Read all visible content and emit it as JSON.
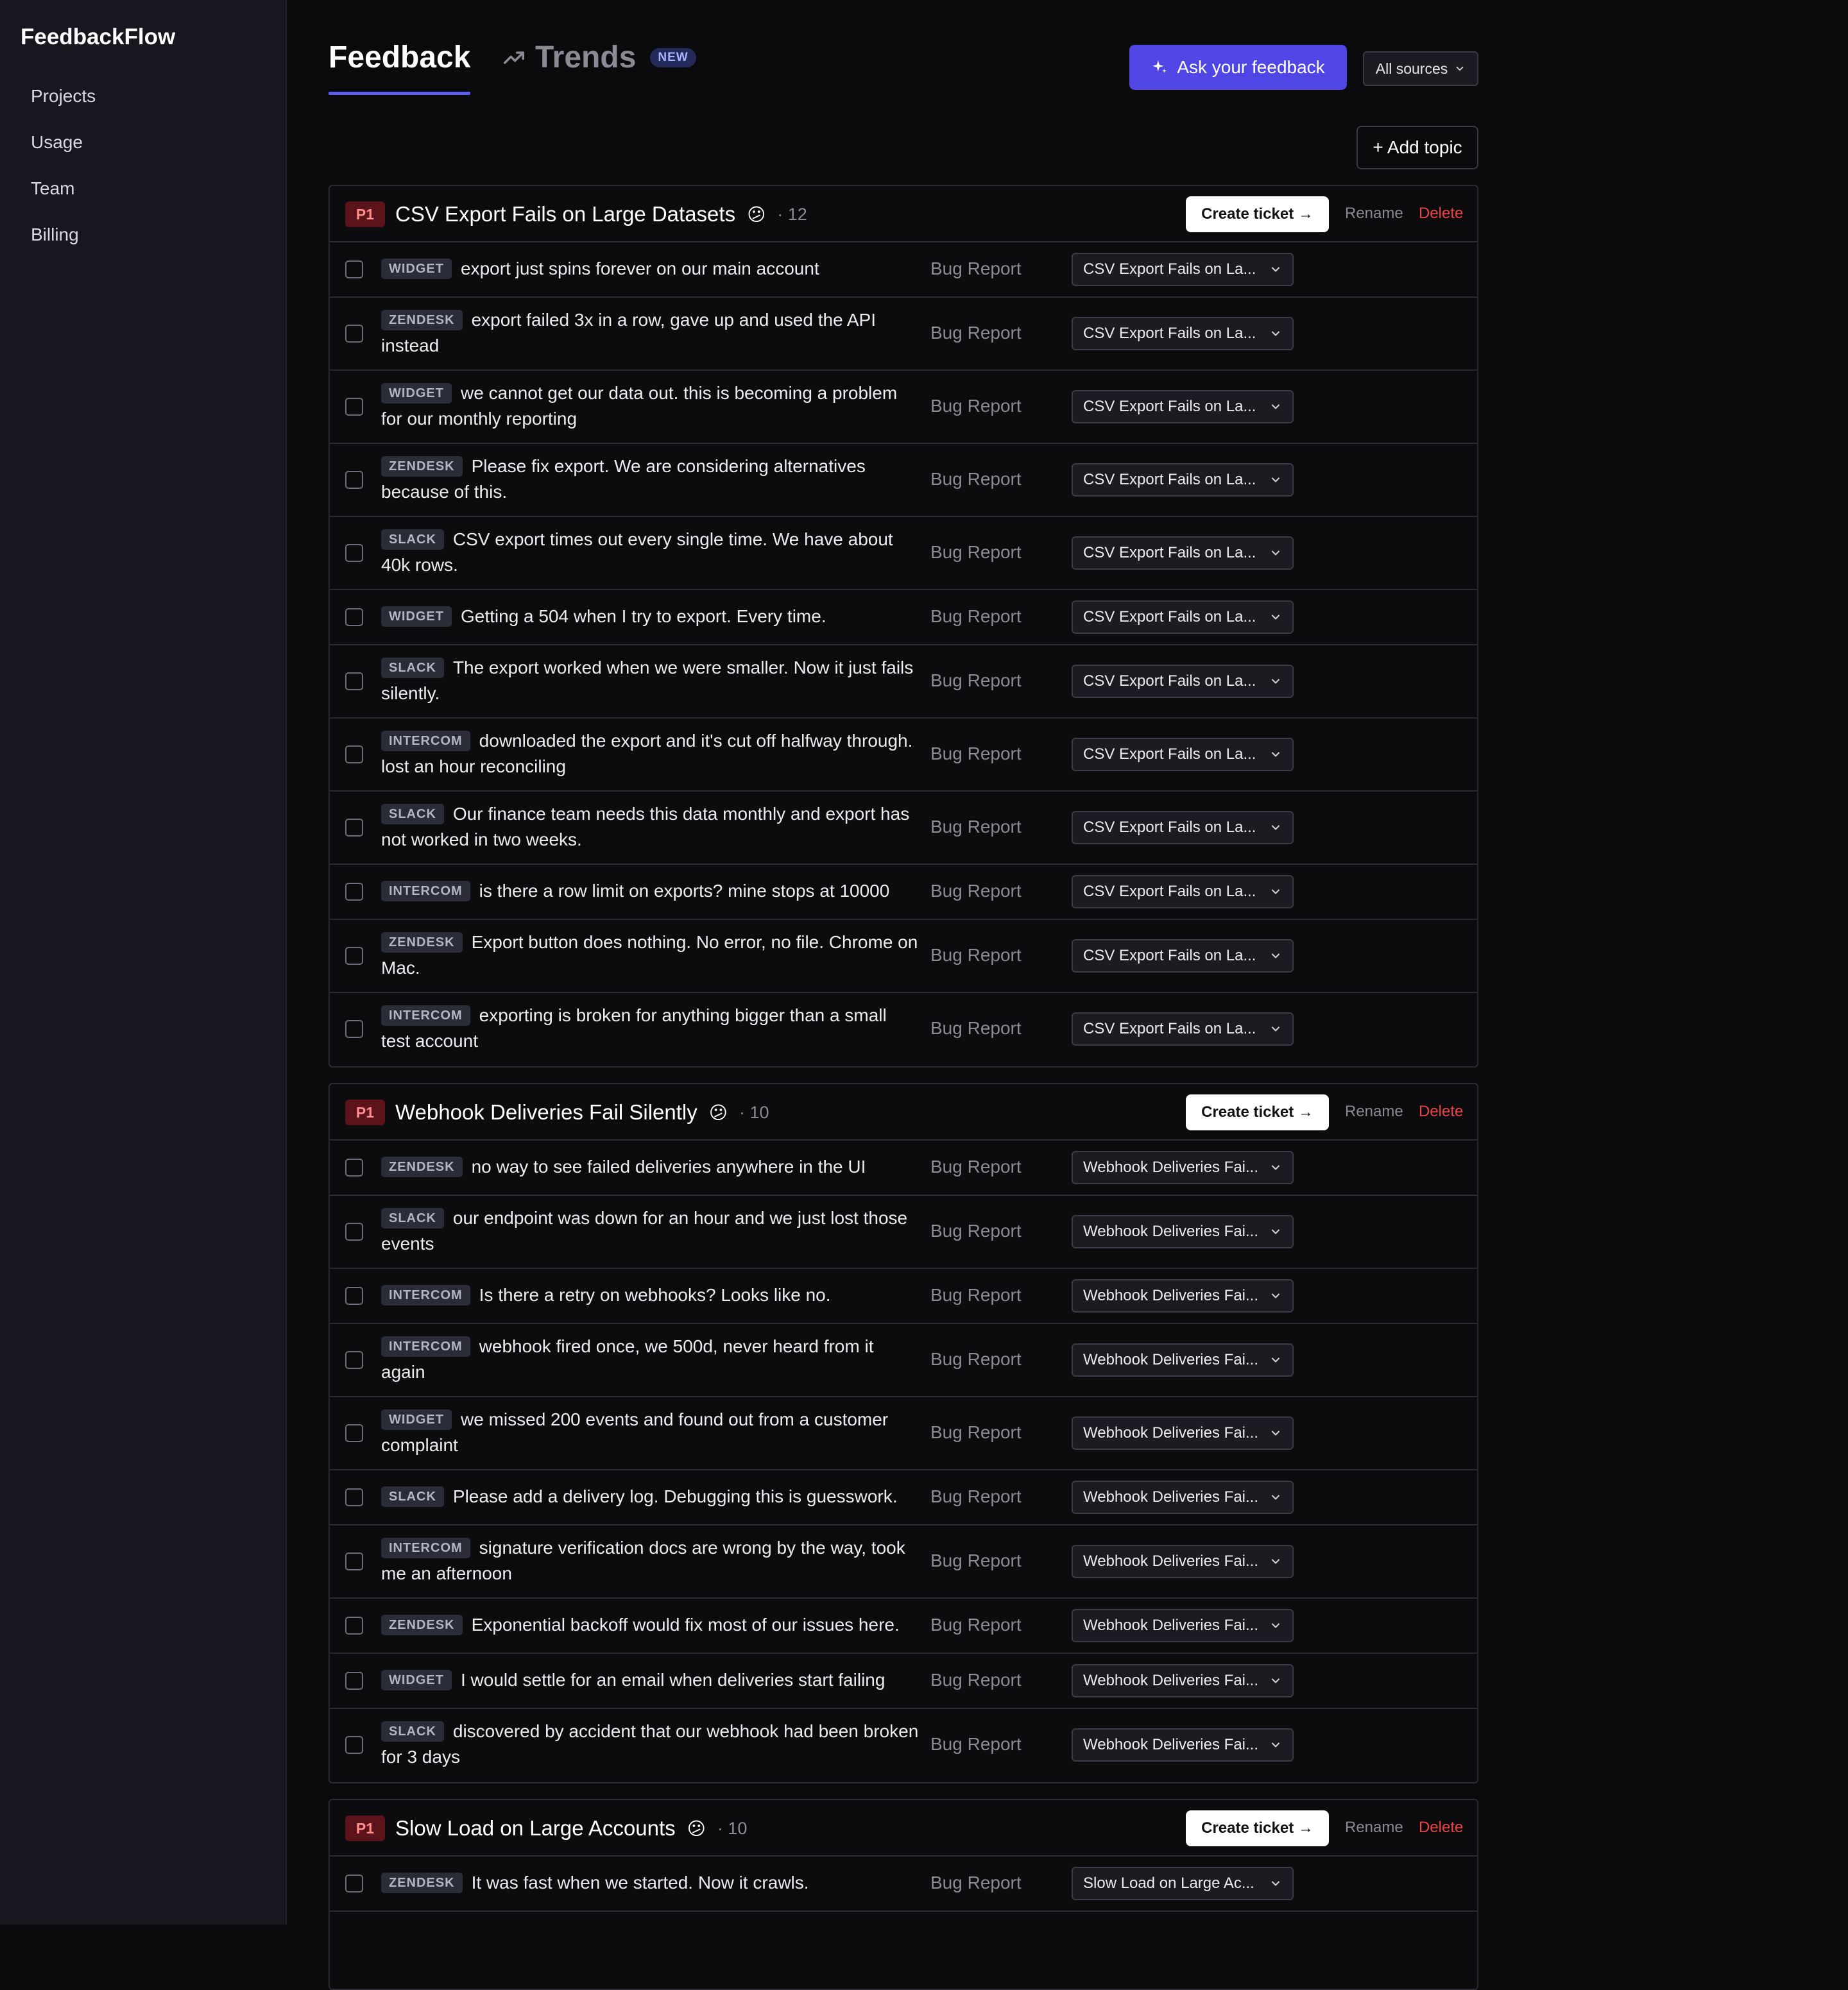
{
  "app": {
    "name": "FeedbackFlow"
  },
  "nav": [
    "Projects",
    "Usage",
    "Team",
    "Billing"
  ],
  "tabs": {
    "feedback": "Feedback",
    "trends": "Trends",
    "trends_badge": "NEW"
  },
  "header": {
    "ask_label": "Ask your feedback",
    "sources_label": "All sources",
    "add_topic_label": "+ Add topic"
  },
  "actions": {
    "create": "Create ticket →",
    "rename": "Rename",
    "delete": "Delete"
  },
  "topics": [
    {
      "priority": "P1",
      "title": "CSV Export Fails on Large Datasets",
      "emoji": "😕",
      "count": "· 12",
      "rows": [
        {
          "source": "WIDGET",
          "text": "export just spins forever on our main account",
          "category": "Bug Report",
          "topic": "CSV Export Fails on La..."
        },
        {
          "source": "ZENDESK",
          "text": "export failed 3x in a row, gave up and used the API instead",
          "category": "Bug Report",
          "topic": "CSV Export Fails on La..."
        },
        {
          "source": "WIDGET",
          "text": "we cannot get our data out. this is becoming a problem for our monthly reporting",
          "category": "Bug Report",
          "topic": "CSV Export Fails on La..."
        },
        {
          "source": "ZENDESK",
          "text": "Please fix export. We are considering alternatives because of this.",
          "category": "Bug Report",
          "topic": "CSV Export Fails on La..."
        },
        {
          "source": "SLACK",
          "text": "CSV export times out every single time. We have about 40k rows.",
          "category": "Bug Report",
          "topic": "CSV Export Fails on La..."
        },
        {
          "source": "WIDGET",
          "text": "Getting a 504 when I try to export. Every time.",
          "category": "Bug Report",
          "topic": "CSV Export Fails on La..."
        },
        {
          "source": "SLACK",
          "text": "The export worked when we were smaller. Now it just fails silently.",
          "category": "Bug Report",
          "topic": "CSV Export Fails on La..."
        },
        {
          "source": "INTERCOM",
          "text": "downloaded the export and it's cut off halfway through. lost an hour reconciling",
          "category": "Bug Report",
          "topic": "CSV Export Fails on La..."
        },
        {
          "source": "SLACK",
          "text": "Our finance team needs this data monthly and export has not worked in two weeks.",
          "category": "Bug Report",
          "topic": "CSV Export Fails on La..."
        },
        {
          "source": "INTERCOM",
          "text": "is there a row limit on exports? mine stops at 10000",
          "category": "Bug Report",
          "topic": "CSV Export Fails on La..."
        },
        {
          "source": "ZENDESK",
          "text": "Export button does nothing. No error, no file. Chrome on Mac.",
          "category": "Bug Report",
          "topic": "CSV Export Fails on La..."
        },
        {
          "source": "INTERCOM",
          "text": "exporting is broken for anything bigger than a small test account",
          "category": "Bug Report",
          "topic": "CSV Export Fails on La..."
        }
      ]
    },
    {
      "priority": "P1",
      "title": "Webhook Deliveries Fail Silently",
      "emoji": "😕",
      "count": "· 10",
      "rows": [
        {
          "source": "ZENDESK",
          "text": "no way to see failed deliveries anywhere in the UI",
          "category": "Bug Report",
          "topic": "Webhook Deliveries Fai..."
        },
        {
          "source": "SLACK",
          "text": "our endpoint was down for an hour and we just lost those events",
          "category": "Bug Report",
          "topic": "Webhook Deliveries Fai..."
        },
        {
          "source": "INTERCOM",
          "text": "Is there a retry on webhooks? Looks like no.",
          "category": "Bug Report",
          "topic": "Webhook Deliveries Fai..."
        },
        {
          "source": "INTERCOM",
          "text": "webhook fired once, we 500d, never heard from it again",
          "category": "Bug Report",
          "topic": "Webhook Deliveries Fai..."
        },
        {
          "source": "WIDGET",
          "text": "we missed 200 events and found out from a customer complaint",
          "category": "Bug Report",
          "topic": "Webhook Deliveries Fai..."
        },
        {
          "source": "SLACK",
          "text": "Please add a delivery log. Debugging this is guesswork.",
          "category": "Bug Report",
          "topic": "Webhook Deliveries Fai..."
        },
        {
          "source": "INTERCOM",
          "text": "signature verification docs are wrong by the way, took me an afternoon",
          "category": "Bug Report",
          "topic": "Webhook Deliveries Fai..."
        },
        {
          "source": "ZENDESK",
          "text": "Exponential backoff would fix most of our issues here.",
          "category": "Bug Report",
          "topic": "Webhook Deliveries Fai..."
        },
        {
          "source": "WIDGET",
          "text": "I would settle for an email when deliveries start failing",
          "category": "Bug Report",
          "topic": "Webhook Deliveries Fai..."
        },
        {
          "source": "SLACK",
          "text": "discovered by accident that our webhook had been broken for 3 days",
          "category": "Bug Report",
          "topic": "Webhook Deliveries Fai..."
        }
      ]
    },
    {
      "priority": "P1",
      "title": "Slow Load on Large Accounts",
      "emoji": "😕",
      "count": "· 10",
      "rows": [
        {
          "source": "ZENDESK",
          "text": "It was fast when we started. Now it crawls.",
          "category": "Bug Report",
          "topic": "Slow Load on Large Ac..."
        },
        {
          "source": "",
          "text": "",
          "category": "",
          "topic": ""
        }
      ]
    }
  ]
}
